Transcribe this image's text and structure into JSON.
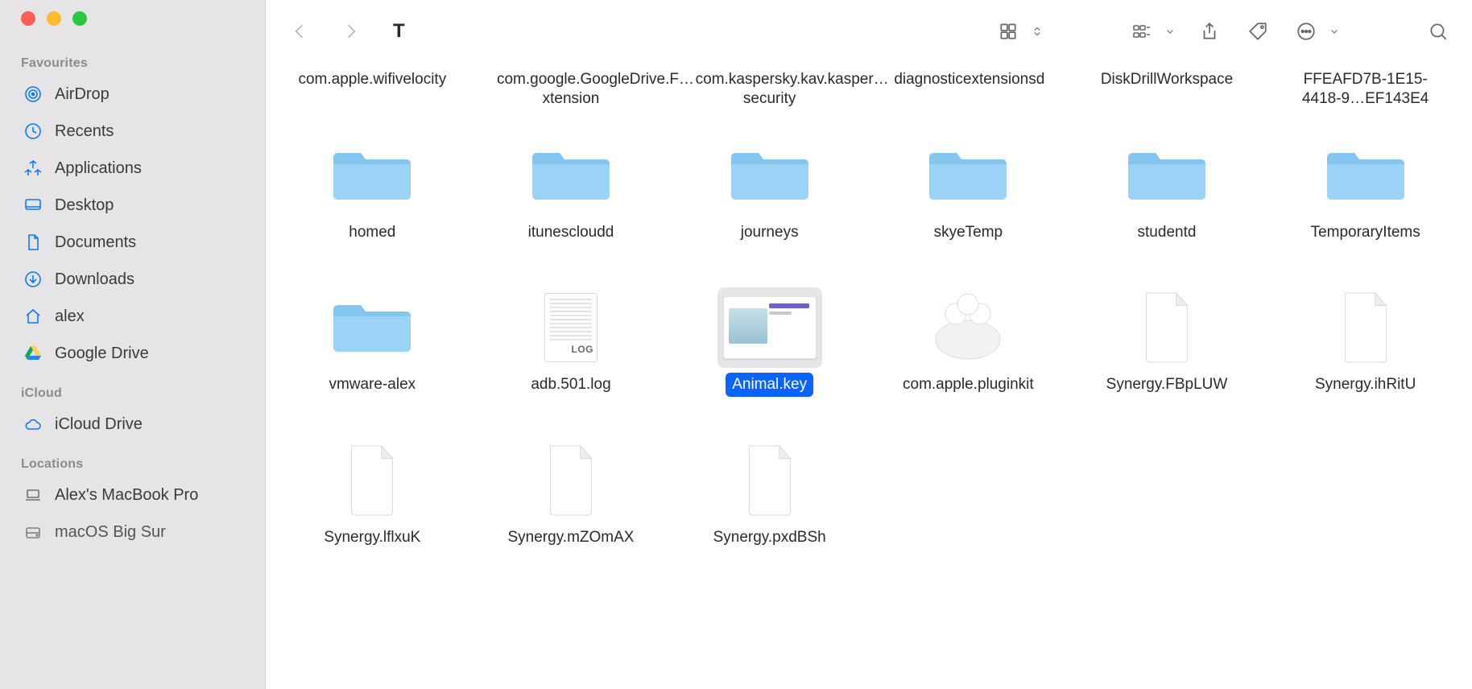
{
  "window": {
    "title": "T"
  },
  "sidebar": {
    "sections": [
      {
        "header": "Favourites",
        "items": [
          {
            "label": "AirDrop",
            "icon": "airdrop"
          },
          {
            "label": "Recents",
            "icon": "clock"
          },
          {
            "label": "Applications",
            "icon": "apps"
          },
          {
            "label": "Desktop",
            "icon": "desktop"
          },
          {
            "label": "Documents",
            "icon": "document"
          },
          {
            "label": "Downloads",
            "icon": "download"
          },
          {
            "label": "alex",
            "icon": "home"
          },
          {
            "label": "Google Drive",
            "icon": "gdrive"
          }
        ]
      },
      {
        "header": "iCloud",
        "items": [
          {
            "label": "iCloud Drive",
            "icon": "cloud"
          }
        ]
      },
      {
        "header": "Locations",
        "items": [
          {
            "label": "Alex's MacBook Pro",
            "icon": "laptop",
            "mono": true
          },
          {
            "label": "macOS Big Sur",
            "icon": "disk",
            "mono": true
          }
        ]
      }
    ]
  },
  "toolbar": {
    "back": "Back",
    "forward": "Forward",
    "viewgrid": "Icon view",
    "viewgroup": "Group",
    "share": "Share",
    "tags": "Tags",
    "more": "More",
    "search": "Search"
  },
  "files": {
    "toprow": [
      {
        "label": "com.apple.wifivelocity"
      },
      {
        "label": "com.google.GoogleDrive.F…xtension"
      },
      {
        "label": "com.kaspersky.kav.kasper…security"
      },
      {
        "label": "diagnosticextensionsd"
      },
      {
        "label": "DiskDrillWorkspace"
      },
      {
        "label": "FFEAFD7B-1E15-4418-9…EF143E4"
      }
    ],
    "row2": [
      {
        "label": "homed",
        "type": "folder"
      },
      {
        "label": "itunescloudd",
        "type": "folder"
      },
      {
        "label": "journeys",
        "type": "folder"
      },
      {
        "label": "skyeTemp",
        "type": "folder"
      },
      {
        "label": "studentd",
        "type": "folder"
      },
      {
        "label": "TemporaryItems",
        "type": "folder"
      }
    ],
    "row3": [
      {
        "label": "vmware-alex",
        "type": "folder"
      },
      {
        "label": "adb.501.log",
        "type": "log",
        "badge": "LOG"
      },
      {
        "label": "Animal.key",
        "type": "keynote",
        "selected": true
      },
      {
        "label": "com.apple.pluginkit",
        "type": "plugin"
      },
      {
        "label": "Synergy.FBpLUW",
        "type": "file"
      },
      {
        "label": "Synergy.ihRitU",
        "type": "file"
      }
    ],
    "row4": [
      {
        "label": "Synergy.lflxuK",
        "type": "file"
      },
      {
        "label": "Synergy.mZOmAX",
        "type": "file"
      },
      {
        "label": "Synergy.pxdBSh",
        "type": "file"
      }
    ]
  }
}
